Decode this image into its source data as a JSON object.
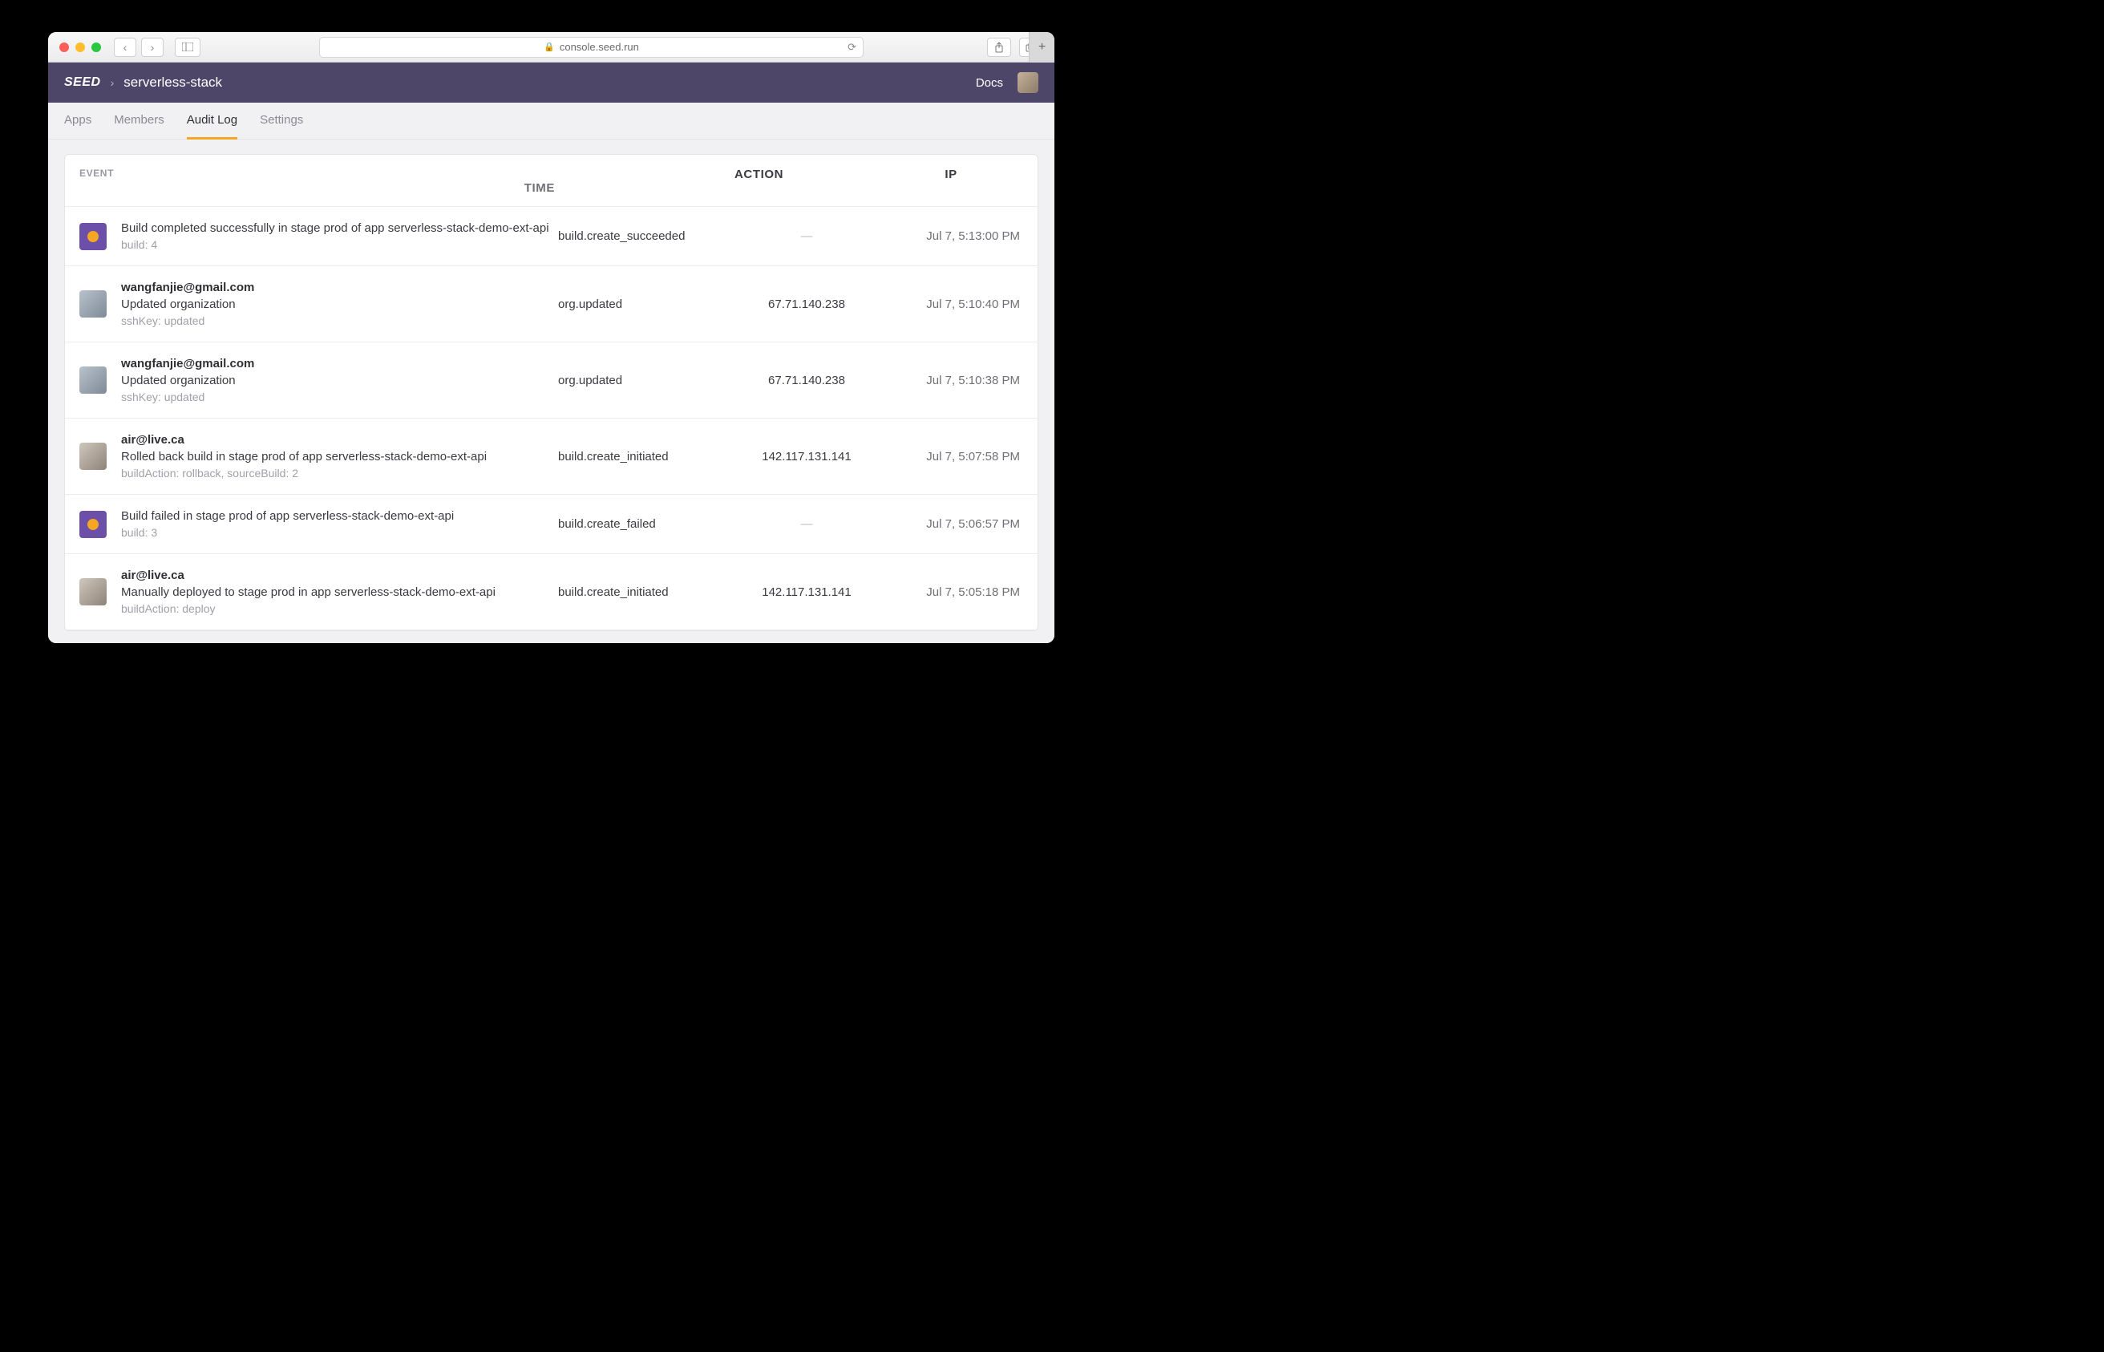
{
  "browser": {
    "url_host": "console.seed.run"
  },
  "header": {
    "logo": "SEED",
    "breadcrumb": "serverless-stack",
    "docs": "Docs"
  },
  "tabs": {
    "items": [
      {
        "label": "Apps",
        "active": false
      },
      {
        "label": "Members",
        "active": false
      },
      {
        "label": "Audit Log",
        "active": true
      },
      {
        "label": "Settings",
        "active": false
      }
    ]
  },
  "table": {
    "headers": {
      "event": "EVENT",
      "action": "ACTION",
      "ip": "IP",
      "time": "TIME"
    },
    "rows": [
      {
        "avatar": "system",
        "user": "",
        "desc": "Build completed successfully in stage prod of app serverless-stack-demo-ext-api",
        "meta": "build: 4",
        "action": "build.create_succeeded",
        "ip": "—",
        "ip_muted": true,
        "time": "Jul 7, 5:13:00 PM"
      },
      {
        "avatar": "user1",
        "user": "wangfanjie@gmail.com",
        "desc": "Updated organization",
        "meta": "sshKey: updated",
        "action": "org.updated",
        "ip": "67.71.140.238",
        "ip_muted": false,
        "time": "Jul 7, 5:10:40 PM"
      },
      {
        "avatar": "user1",
        "user": "wangfanjie@gmail.com",
        "desc": "Updated organization",
        "meta": "sshKey: updated",
        "action": "org.updated",
        "ip": "67.71.140.238",
        "ip_muted": false,
        "time": "Jul 7, 5:10:38 PM"
      },
      {
        "avatar": "user2",
        "user": "air@live.ca",
        "desc": "Rolled back build in stage prod of app serverless-stack-demo-ext-api",
        "meta": "buildAction: rollback, sourceBuild: 2",
        "action": "build.create_initiated",
        "ip": "142.117.131.141",
        "ip_muted": false,
        "time": "Jul 7, 5:07:58 PM"
      },
      {
        "avatar": "system",
        "user": "",
        "desc": "Build failed in stage prod of app serverless-stack-demo-ext-api",
        "meta": "build: 3",
        "action": "build.create_failed",
        "ip": "—",
        "ip_muted": true,
        "time": "Jul 7, 5:06:57 PM"
      },
      {
        "avatar": "user2",
        "user": "air@live.ca",
        "desc": "Manually deployed to stage prod in app serverless-stack-demo-ext-api",
        "meta": "buildAction: deploy",
        "action": "build.create_initiated",
        "ip": "142.117.131.141",
        "ip_muted": false,
        "time": "Jul 7, 5:05:18 PM"
      }
    ]
  }
}
